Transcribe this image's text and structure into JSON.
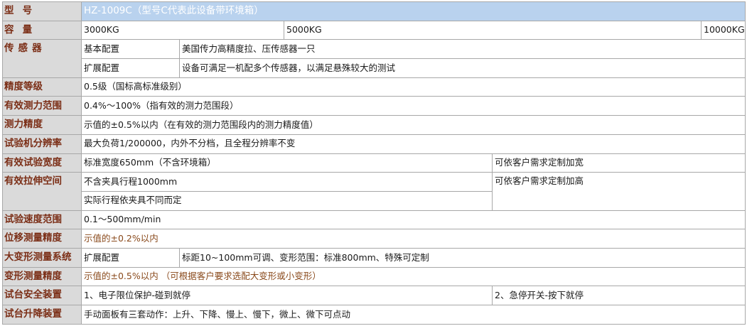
{
  "rows": {
    "model": {
      "label_a": "型",
      "label_b": "号",
      "value": "HZ-1009C（型号C代表此设备带环境箱）"
    },
    "capacity": {
      "label_a": "容",
      "label_b": "量",
      "values": [
        "3000KG",
        "5000KG",
        "10000KG"
      ]
    },
    "sensor": {
      "label": "传 感 器",
      "basic": {
        "sub": "基本配置",
        "value": "美国传力高精度拉、压传感器一只"
      },
      "extended": {
        "sub": "扩展配置",
        "value": "设备可满足一机配多个传感器，以满足悬殊较大的测试"
      }
    },
    "accuracy_grade": {
      "label": "精度等级",
      "value": "0.5级（国标高标准级别）"
    },
    "force_range": {
      "label": "有效测力范围",
      "value": "0.4%～100%（指有效的测力范围段）"
    },
    "force_accuracy": {
      "label": "测力精度",
      "value": "示值的±0.5%以内（在有效的测力范围段内的测力精度值）"
    },
    "resolution": {
      "label": "试验机分辨率",
      "value": "最大负荷1/200000，内外不分档，且全程分辨率不变"
    },
    "test_width": {
      "label": "有效试验宽度",
      "value": "标准宽度650mm（不含环境箱）",
      "note": "可依客户需求定制加宽"
    },
    "tensile_space": {
      "label": "有效拉伸空间",
      "value_1": "不含夹具行程1000mm",
      "value_2": "实际行程依夹具不同而定",
      "note": "可依客户需求定制加高"
    },
    "speed_range": {
      "label": "试验速度范围",
      "value": "0.1～500mm/min"
    },
    "displacement_accuracy": {
      "label": "位移测量精度",
      "value": "示值的±0.2%以内"
    },
    "large_deformation": {
      "label": "大变形测量系统",
      "sub": "扩展配置",
      "value": "标距10~100mm可调、变形范围：标准800mm、特殊可定制"
    },
    "deformation_accuracy": {
      "label": "变形测量精度",
      "value": "示值的±0.5%以内 （可根据客户要求选配大变形或小变形）"
    },
    "safety": {
      "label": "试台安全装置",
      "value_1": "1、电子限位保护-碰到就停",
      "value_2": "2、急停开关-按下就停"
    },
    "lifting": {
      "label": "试台升降装置",
      "value": "手动面板有三套动作：上升、下降、慢上、慢下，微上、微下可点动"
    }
  }
}
